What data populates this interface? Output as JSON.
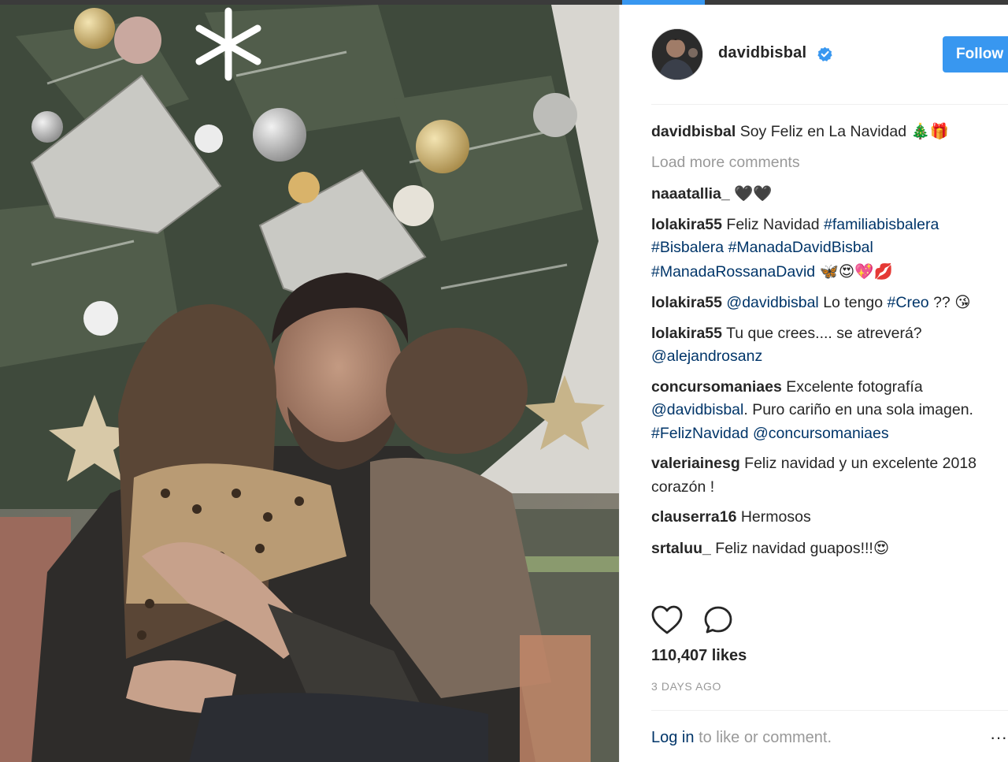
{
  "post": {
    "username": "davidbisbal",
    "follow_label": "Follow",
    "caption_author": "davidbisbal",
    "caption_text": "Soy Feliz en La Navidad",
    "caption_emojis": "🎄🎁",
    "load_more_label": "Load more comments",
    "likes": "110,407 likes",
    "timestamp": "3 DAYS AGO",
    "login_link": "Log in",
    "login_rest": "to like or comment.",
    "more_label": "···"
  },
  "comments": [
    {
      "author": "naaatallia_",
      "text": "",
      "emoji": "🖤🖤"
    },
    {
      "author": "lolakira55",
      "text1": "Feliz Navidad",
      "tag1": "#familiabisbalera",
      "tag2": "#Bisbalera",
      "tag3": "#ManadaDavidBisbal",
      "tag4": "#ManadaRossanaDavid",
      "emoji": "🦋😍💖💋"
    },
    {
      "author": "lolakira55",
      "mention": "@davidbisbal",
      "text1": "Lo tengo",
      "tag1": "#Creo",
      "text2": "??",
      "emoji": "😘"
    },
    {
      "author": "lolakira55",
      "text1": "Tu que crees.... se atreverá?",
      "mention": "@alejandrosanz"
    },
    {
      "author": "concursomaniaes",
      "text1": "Excelente fotografía",
      "mention": "@davidbisbal",
      "text2": ". Puro cariño en una sola imagen.",
      "tag1": "#FelizNavidad",
      "mention2": "@concursomaniaes"
    },
    {
      "author": "valeriainesg",
      "text1": "Feliz navidad y un excelente 2018 corazón !"
    },
    {
      "author": "clauserra16",
      "text1": "Hermosos"
    },
    {
      "author": "srtaluu_",
      "text1": "Feliz navidad guapos!!!",
      "emoji": "😍"
    }
  ],
  "colors": {
    "accent": "#3897f0",
    "link": "#003569",
    "muted": "#999999",
    "text": "#262626"
  },
  "icons": [
    "verified-badge-icon",
    "heart-icon",
    "comment-bubble-icon",
    "more-options-icon"
  ]
}
